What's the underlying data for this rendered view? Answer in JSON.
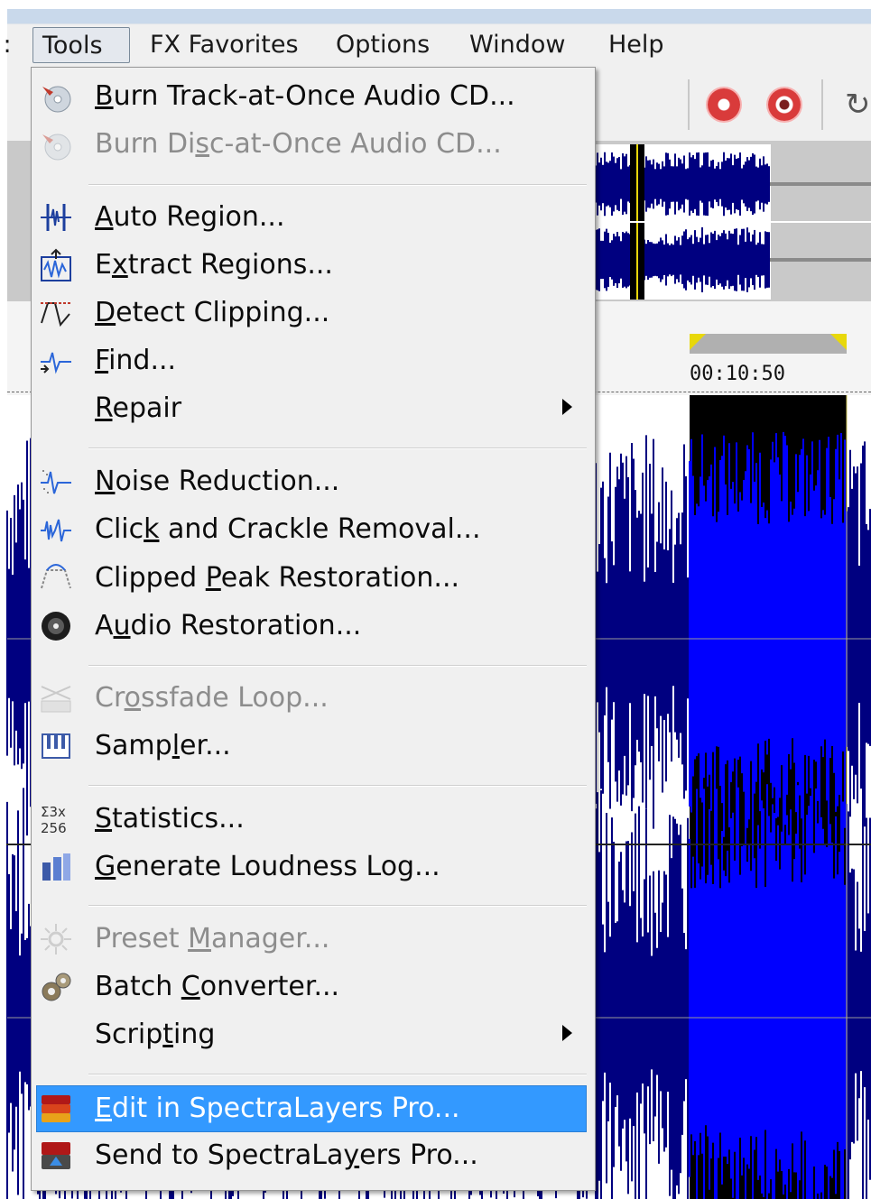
{
  "menubar": {
    "edge_label": ":",
    "items": [
      "Tools",
      "FX Favorites",
      "Options",
      "Window",
      "Help"
    ]
  },
  "timeline": {
    "timecode": "00:10:50"
  },
  "menu": {
    "items": [
      {
        "label": "Burn Track-at-Once Audio CD...",
        "mnemonic": "B",
        "icon": "cd-burn-icon",
        "enabled": true
      },
      {
        "label": "Burn Disc-at-Once Audio CD...",
        "mnemonic": "s",
        "icon": "cd-burn-icon",
        "enabled": false
      },
      {
        "label": "Auto Region...",
        "mnemonic": "A",
        "icon": "auto-region-icon",
        "enabled": true
      },
      {
        "label": "Extract Regions...",
        "mnemonic": "x",
        "icon": "extract-regions-icon",
        "enabled": true
      },
      {
        "label": "Detect Clipping...",
        "mnemonic": "D",
        "icon": "detect-clipping-icon",
        "enabled": true
      },
      {
        "label": "Find...",
        "mnemonic": "F",
        "icon": "find-waveform-icon",
        "enabled": true
      },
      {
        "label": "Repair",
        "mnemonic": "R",
        "icon": "",
        "enabled": true,
        "submenu": true
      },
      {
        "label": "Noise Reduction...",
        "mnemonic": "N",
        "icon": "noise-reduction-icon",
        "enabled": true
      },
      {
        "label": "Click and Crackle Removal...",
        "mnemonic": "k",
        "icon": "click-crackle-icon",
        "enabled": true
      },
      {
        "label": "Clipped Peak Restoration...",
        "mnemonic": "P",
        "icon": "clipped-peak-icon",
        "enabled": true
      },
      {
        "label": "Audio Restoration...",
        "mnemonic": "u",
        "icon": "audio-restoration-icon",
        "enabled": true
      },
      {
        "label": "Crossfade Loop...",
        "mnemonic": "o",
        "icon": "crossfade-loop-icon",
        "enabled": false
      },
      {
        "label": "Sampler...",
        "mnemonic": "l",
        "icon": "sampler-icon",
        "enabled": true
      },
      {
        "label": "Statistics...",
        "mnemonic": "S",
        "icon": "statistics-icon",
        "enabled": true
      },
      {
        "label": "Generate Loudness Log...",
        "mnemonic": "G",
        "icon": "loudness-log-icon",
        "enabled": true
      },
      {
        "label": "Preset Manager...",
        "mnemonic": "M",
        "icon": "preset-manager-icon",
        "enabled": false
      },
      {
        "label": "Batch Converter...",
        "mnemonic": "C",
        "icon": "batch-converter-icon",
        "enabled": true
      },
      {
        "label": "Scripting",
        "mnemonic": "t",
        "icon": "",
        "enabled": true,
        "submenu": true
      },
      {
        "label": "Edit in SpectraLayers Pro...",
        "mnemonic": "E",
        "icon": "spectralayers-icon",
        "enabled": true,
        "highlighted": true
      },
      {
        "label": "Send to SpectraLayers Pro...",
        "mnemonic": "y",
        "icon": "spectralayers-send-icon",
        "enabled": true
      }
    ]
  },
  "colors": {
    "highlight": "#3399ff",
    "waveform": "#000080",
    "waveform_selected": "#0000ff",
    "selection_background": "#000000",
    "record_button": "#d93b3b",
    "marker": "#e8d80a"
  }
}
